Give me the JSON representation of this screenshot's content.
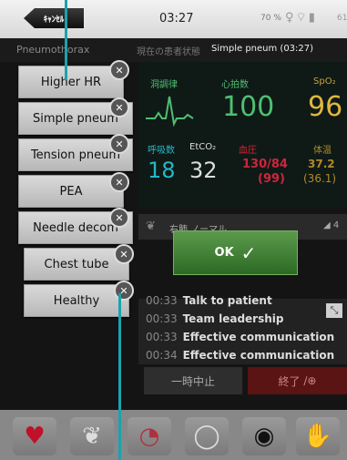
{
  "status_bar": {
    "cancel_label": "ｷｬﾝｾﾙ",
    "time": "03:27",
    "battery_left": "70 %",
    "battery_right": "61"
  },
  "header": {
    "scenario": "Pneumothorax",
    "state_label": "現在の患者状態",
    "state_value": "Simple pneum (03:27)"
  },
  "vitals": {
    "rhythm_label": "洞調律",
    "hr_label": "心拍数",
    "hr_value": "100",
    "spo2_label": "SpO₂",
    "spo2_value": "96",
    "rr_label": "呼吸数",
    "rr_value": "18",
    "etco2_label": "EtCO₂",
    "etco2_value": "32",
    "bp_label": "血圧",
    "bp_value": "130/84",
    "bp_mean": "(99)",
    "temp_label": "体温",
    "temp_value": "37.2",
    "temp_sub": "(36.1)"
  },
  "breath_banner": {
    "text": "右肺 ノーマル",
    "signal": "◢ 4"
  },
  "ok_button": {
    "label": "OK",
    "check": "✓"
  },
  "log": [
    {
      "time": "00:33",
      "event": "Talk to patient"
    },
    {
      "time": "00:33",
      "event": "Team leadership"
    },
    {
      "time": "00:33",
      "event": "Effective communication"
    },
    {
      "time": "00:34",
      "event": "Effective communication"
    }
  ],
  "controls": {
    "pause": "一時中止",
    "end": "終了"
  },
  "commands": [
    {
      "label": "Higher HR"
    },
    {
      "label": "Simple pneum"
    },
    {
      "label": "Tension pneum"
    },
    {
      "label": "PEA"
    },
    {
      "label": "Needle decom"
    },
    {
      "label": "Chest tube"
    },
    {
      "label": "Healthy"
    }
  ],
  "dock_icons": [
    "heart-icon",
    "lungs-icon",
    "stomach-icon",
    "speech-bubble-icon",
    "eye-icon",
    "gloves-icon"
  ],
  "colors": {
    "green": "#4fbf73",
    "cyan": "#24b7c9",
    "red": "#d0243c",
    "orange": "#b08a2a",
    "accent": "#1aa3ad"
  }
}
